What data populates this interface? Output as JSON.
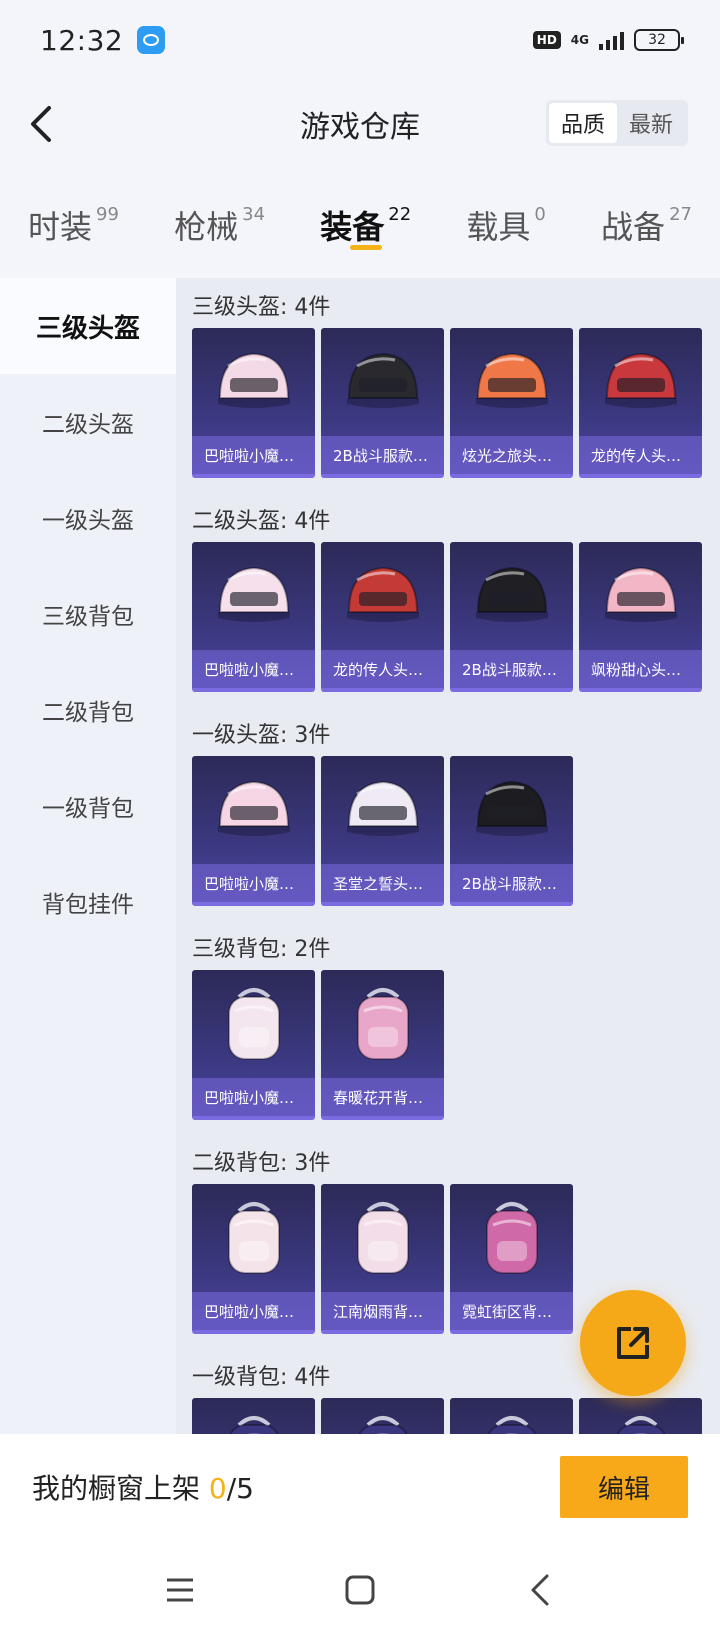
{
  "status_bar": {
    "time": "12:32",
    "hd": "HD",
    "network": "4G",
    "battery": "32"
  },
  "header": {
    "title": "游戏仓库",
    "sort_options": [
      "品质",
      "最新"
    ],
    "active_sort": "品质"
  },
  "tabs": [
    {
      "label": "时装",
      "count": "99"
    },
    {
      "label": "枪械",
      "count": "34"
    },
    {
      "label": "装备",
      "count": "22",
      "active": true
    },
    {
      "label": "载具",
      "count": "0"
    },
    {
      "label": "战备",
      "count": "27"
    }
  ],
  "sidebar": {
    "items": [
      "三级头盔",
      "二级头盔",
      "一级头盔",
      "三级背包",
      "二级背包",
      "一级背包",
      "背包挂件"
    ],
    "active": "三级头盔"
  },
  "sections": [
    {
      "title": "三级头盔: 4件",
      "items": [
        {
          "label": "巴啦啦小魔…",
          "icon": "helmet-icon",
          "color": "#f4d9e6"
        },
        {
          "label": "2B战斗服款…",
          "icon": "helmet-icon",
          "color": "#2a2a2e"
        },
        {
          "label": "炫光之旅头…",
          "icon": "helmet-icon",
          "color": "#f07848"
        },
        {
          "label": "龙的传人头…",
          "icon": "helmet-icon",
          "color": "#c8383c"
        }
      ]
    },
    {
      "title": "二级头盔: 4件",
      "items": [
        {
          "label": "巴啦啦小魔…",
          "icon": "helmet-icon",
          "color": "#f5e0ec"
        },
        {
          "label": "龙的传人头…",
          "icon": "helmet-icon",
          "color": "#c43a36"
        },
        {
          "label": "2B战斗服款…",
          "icon": "helmet-icon",
          "color": "#1f1f24"
        },
        {
          "label": "飒粉甜心头…",
          "icon": "helmet-icon",
          "color": "#f2b6c6"
        }
      ]
    },
    {
      "title": "一级头盔: 3件",
      "items": [
        {
          "label": "巴啦啦小魔…",
          "icon": "helmet-icon",
          "color": "#f6d6e4"
        },
        {
          "label": "圣堂之誓头…",
          "icon": "helmet-icon",
          "color": "#efeaf4"
        },
        {
          "label": "2B战斗服款…",
          "icon": "helmet-icon",
          "color": "#1d1d21"
        }
      ]
    },
    {
      "title": "三级背包: 2件",
      "items": [
        {
          "label": "巴啦啦小魔…",
          "icon": "backpack-icon",
          "color": "#f3e6ee"
        },
        {
          "label": "春暖花开背…",
          "icon": "backpack-icon",
          "color": "#e8a6c8"
        }
      ]
    },
    {
      "title": "二级背包: 3件",
      "items": [
        {
          "label": "巴啦啦小魔…",
          "icon": "backpack-icon",
          "color": "#f4e4ea"
        },
        {
          "label": "江南烟雨背…",
          "icon": "backpack-icon",
          "color": "#f2dde8"
        },
        {
          "label": "霓虹街区背…",
          "icon": "backpack-icon",
          "color": "#d069a8"
        }
      ]
    },
    {
      "title": "一级背包: 4件",
      "items": [
        {
          "label": "",
          "icon": "backpack-icon",
          "color": "#3a3780"
        },
        {
          "label": "",
          "icon": "backpack-icon",
          "color": "#3a3780"
        },
        {
          "label": "",
          "icon": "backpack-icon",
          "color": "#3a3780"
        },
        {
          "label": "",
          "icon": "backpack-icon",
          "color": "#3a3780"
        }
      ]
    }
  ],
  "bottom_bar": {
    "showcase_label": "我的橱窗上架",
    "showcase_current": "0",
    "showcase_total": "/5",
    "edit_label": "编辑"
  },
  "colors": {
    "accent": "#f5b317",
    "card_bg": "#3b3880"
  }
}
